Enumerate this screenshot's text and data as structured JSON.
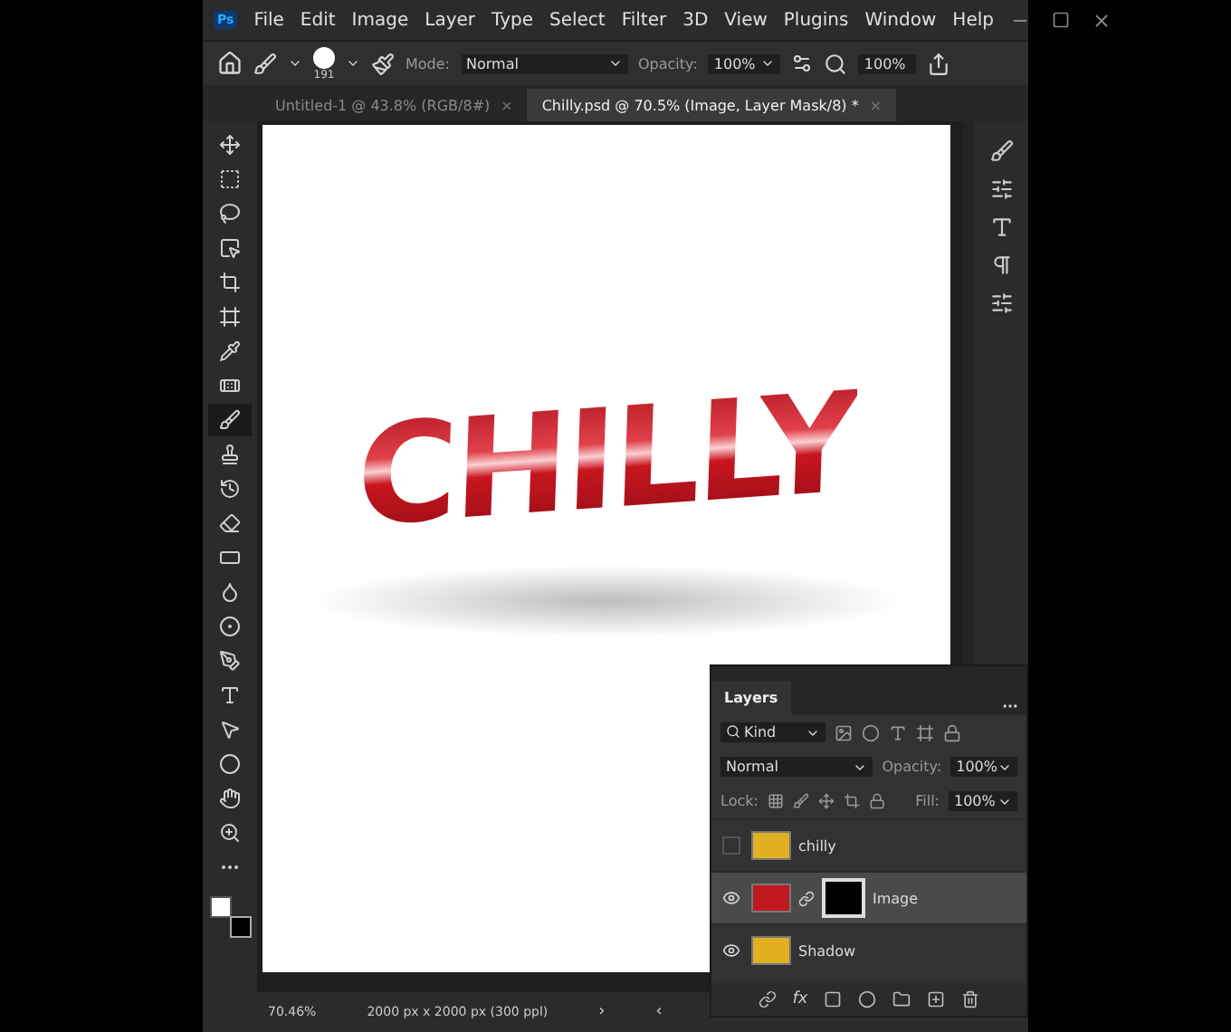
{
  "app_badge": "Ps",
  "menu": [
    "File",
    "Edit",
    "Image",
    "Layer",
    "Type",
    "Select",
    "Filter",
    "3D",
    "View",
    "Plugins",
    "Window",
    "Help"
  ],
  "options_bar": {
    "brush_size": "191",
    "mode_label": "Mode:",
    "mode": "Normal",
    "opacity_label": "Opacity:",
    "opacity": "100%",
    "zoom": "100%"
  },
  "tabs": [
    {
      "label": "Untitled-1 @ 43.8% (RGB/8#)",
      "close": "×",
      "selected": false
    },
    {
      "label": "Chilly.psd @ 70.5% (Image, Layer Mask/8) *",
      "close": "×",
      "selected": true
    }
  ],
  "tools": [
    {
      "kind": "move",
      "selected": false
    },
    {
      "kind": "marquee",
      "selected": false
    },
    {
      "kind": "lasso",
      "selected": false
    },
    {
      "kind": "object-select",
      "selected": false
    },
    {
      "kind": "crop",
      "selected": false
    },
    {
      "kind": "frame",
      "selected": false
    },
    {
      "kind": "eyedropper",
      "selected": false
    },
    {
      "kind": "healing",
      "selected": false
    },
    {
      "kind": "brush",
      "selected": true
    },
    {
      "kind": "stamp",
      "selected": false
    },
    {
      "kind": "history",
      "selected": false
    },
    {
      "kind": "eraser",
      "selected": false
    },
    {
      "kind": "gradient",
      "selected": false
    },
    {
      "kind": "blur",
      "selected": false
    },
    {
      "kind": "dodge",
      "selected": false
    },
    {
      "kind": "pen",
      "selected": false
    },
    {
      "kind": "type",
      "selected": false
    },
    {
      "kind": "path-select",
      "selected": false
    },
    {
      "kind": "shape",
      "selected": false
    },
    {
      "kind": "hand",
      "selected": false
    },
    {
      "kind": "zoom",
      "selected": false
    },
    {
      "kind": "more",
      "selected": false
    }
  ],
  "document": {
    "artwork_text": "CHILLY"
  },
  "status_bar": {
    "zoom": "70.46%",
    "size": "2000 px x 2000 px (300 ppl)",
    "next": "›",
    "prev": "‹"
  },
  "layers_panel": {
    "title": "Layers",
    "filter": "Kind",
    "blend_mode": "Normal",
    "opacity_label": "Opacity:",
    "opacity": "100%",
    "lock_label": "Lock:",
    "fill_label": "Fill:",
    "fill": "100%",
    "fx": "fx",
    "items": [
      {
        "name": "chilly",
        "kind": "smart",
        "visible": false,
        "selected": false
      },
      {
        "name": "Image",
        "kind": "masked",
        "visible": true,
        "selected": true
      },
      {
        "name": "Shadow",
        "kind": "smart",
        "visible": true,
        "selected": false
      }
    ]
  }
}
